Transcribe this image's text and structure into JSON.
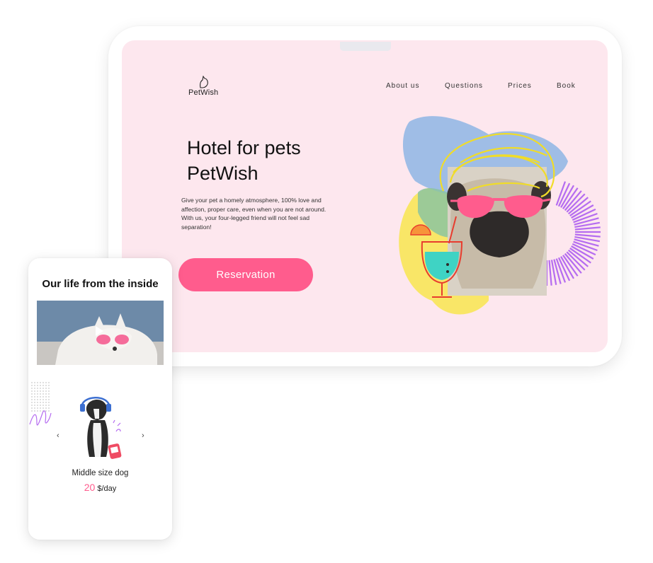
{
  "tablet": {
    "logo_text": "PetWish",
    "nav": {
      "about": "About us",
      "questions": "Questions",
      "prices": "Prices",
      "book": "Book"
    },
    "hero": {
      "title_line1": "Hotel for pets",
      "title_line2": "PetWish",
      "description": "Give your pet a homely atmosphere, 100% love and affection, proper care, even when you are not around. With us, your four-legged friend will not feel sad separation!",
      "reservation_label": "Reservation"
    }
  },
  "phone": {
    "title": "Our life from the inside",
    "product": {
      "name": "Middle size dog",
      "price_value": "20",
      "price_unit": "$/day"
    },
    "arrow_prev": "‹",
    "arrow_next": "›"
  },
  "colors": {
    "accent_pink": "#ff5c8d",
    "screen_background": "#fde7ee",
    "blob_blue": "#9fbde6",
    "blob_yellow": "#f9e667",
    "ray_purple": "#b56cf0"
  },
  "icons": [
    "cat-logo-icon",
    "play-icon",
    "chevron-left-icon",
    "chevron-right-icon"
  ]
}
